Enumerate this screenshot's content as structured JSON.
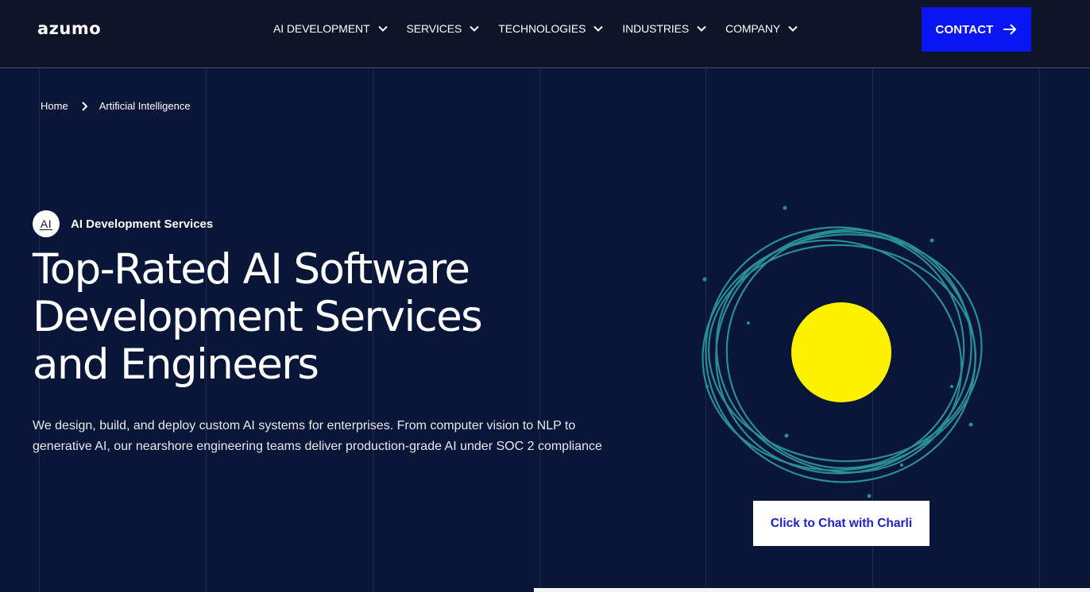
{
  "nav": {
    "logo": "azumo",
    "items": [
      {
        "label": "AI DEVELOPMENT"
      },
      {
        "label": "SERVICES"
      },
      {
        "label": "TECHNOLOGIES"
      },
      {
        "label": "INDUSTRIES"
      },
      {
        "label": "COMPANY"
      }
    ],
    "contact_label": "CONTACT"
  },
  "breadcrumb": {
    "home": "Home",
    "current": "Artificial Intelligence"
  },
  "hero": {
    "badge": "AI",
    "eyebrow": "AI Development Services",
    "headline_line1": "Top-Rated AI Software",
    "headline_line2": "Development Services",
    "headline_line3": "and Engineers",
    "subtext": "We design, build, and deploy custom AI systems for enterprises. From computer vision to NLP to generative AI, our nearshore engineering teams deliver production-grade AI under SOC 2 compliance",
    "chat_label": "Click to Chat with Charli"
  },
  "colors": {
    "background": "#0a1637",
    "nav_background": "#0e1528",
    "contact_button": "#0a16f2",
    "orbit_stroke": "#2a8e95",
    "sun": "#fff200",
    "chat_text": "#1d22c9"
  },
  "icons": {
    "menu_chevron": "chevron-down-icon",
    "contact_arrow": "arrow-right-icon",
    "breadcrumb_separator": "chevron-right-icon"
  }
}
